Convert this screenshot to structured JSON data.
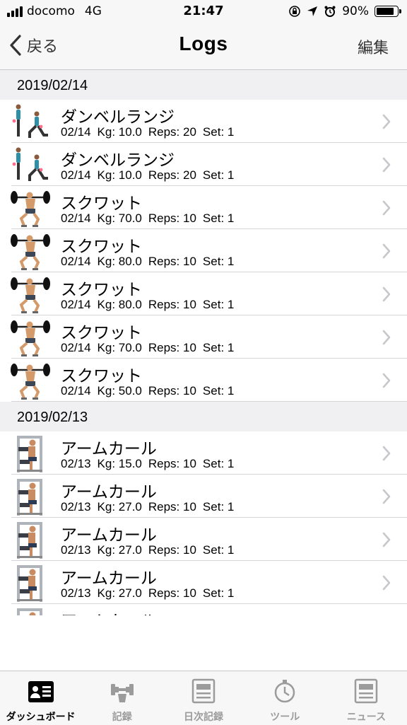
{
  "status_bar": {
    "carrier": "docomo",
    "network": "4G",
    "time": "21:47",
    "battery": "90%",
    "battery_level": 0.9
  },
  "nav": {
    "back_label": "戻る",
    "title": "Logs",
    "edit_label": "編集"
  },
  "sections": [
    {
      "date": "2019/02/14",
      "rows": [
        {
          "title": "ダンベルランジ",
          "date": "02/14",
          "kg": "Kg: 10.0",
          "reps": "Reps: 20",
          "set": "Set: 1",
          "icon": "lunge-exercise-icon"
        },
        {
          "title": "ダンベルランジ",
          "date": "02/14",
          "kg": "Kg: 10.0",
          "reps": "Reps: 20",
          "set": "Set: 1",
          "icon": "lunge-exercise-icon"
        },
        {
          "title": "スクワット",
          "date": "02/14",
          "kg": "Kg: 70.0",
          "reps": "Reps: 10",
          "set": "Set: 1",
          "icon": "squat-exercise-icon"
        },
        {
          "title": "スクワット",
          "date": "02/14",
          "kg": "Kg: 80.0",
          "reps": "Reps: 10",
          "set": "Set: 1",
          "icon": "squat-exercise-icon"
        },
        {
          "title": "スクワット",
          "date": "02/14",
          "kg": "Kg: 80.0",
          "reps": "Reps: 10",
          "set": "Set: 1",
          "icon": "squat-exercise-icon"
        },
        {
          "title": "スクワット",
          "date": "02/14",
          "kg": "Kg: 70.0",
          "reps": "Reps: 10",
          "set": "Set: 1",
          "icon": "squat-exercise-icon"
        },
        {
          "title": "スクワット",
          "date": "02/14",
          "kg": "Kg: 50.0",
          "reps": "Reps: 10",
          "set": "Set: 1",
          "icon": "squat-exercise-icon"
        }
      ]
    },
    {
      "date": "2019/02/13",
      "rows": [
        {
          "title": "アームカール",
          "date": "02/13",
          "kg": "Kg: 15.0",
          "reps": "Reps: 10",
          "set": "Set: 1",
          "icon": "arm-curl-machine-icon"
        },
        {
          "title": "アームカール",
          "date": "02/13",
          "kg": "Kg: 27.0",
          "reps": "Reps: 10",
          "set": "Set: 1",
          "icon": "arm-curl-machine-icon"
        },
        {
          "title": "アームカール",
          "date": "02/13",
          "kg": "Kg: 27.0",
          "reps": "Reps: 10",
          "set": "Set: 1",
          "icon": "arm-curl-machine-icon"
        },
        {
          "title": "アームカール",
          "date": "02/13",
          "kg": "Kg: 27.0",
          "reps": "Reps: 10",
          "set": "Set: 1",
          "icon": "arm-curl-machine-icon"
        },
        {
          "title": "アームカール",
          "date": "",
          "kg": "",
          "reps": "",
          "set": "",
          "icon": "arm-curl-machine-icon"
        }
      ]
    }
  ],
  "tabs": [
    {
      "label": "ダッシュボード",
      "icon": "dashboard-icon",
      "active": true
    },
    {
      "label": "記録",
      "icon": "dumbbell-icon",
      "active": false
    },
    {
      "label": "日次記録",
      "icon": "daily-log-icon",
      "active": false
    },
    {
      "label": "ツール",
      "icon": "stopwatch-icon",
      "active": false
    },
    {
      "label": "ニュース",
      "icon": "news-icon",
      "active": false
    }
  ],
  "colors": {
    "bar_background": "#f7f7f7",
    "section_background": "#f0f0f2",
    "separator": "#d6d6da",
    "tab_inactive": "#9b9b9b",
    "tab_active": "#000000"
  }
}
